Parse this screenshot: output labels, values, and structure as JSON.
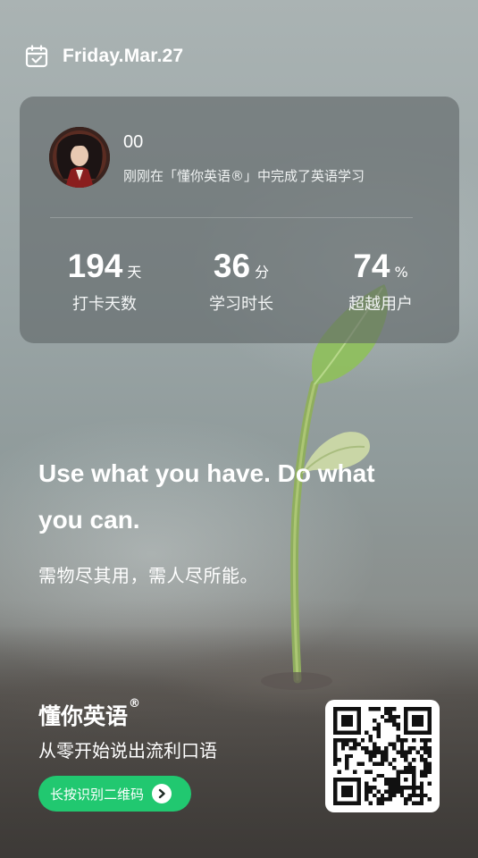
{
  "header": {
    "date": "Friday.Mar.27"
  },
  "user": {
    "name": "00",
    "status": "刚刚在「懂你英语®」中完成了英语学习"
  },
  "stats": [
    {
      "value": "194",
      "unit": "天",
      "label": "打卡天数"
    },
    {
      "value": "36",
      "unit": "分",
      "label": "学习时长"
    },
    {
      "value": "74",
      "unit": "%",
      "label": "超越用户"
    }
  ],
  "quote": {
    "english": "Use what you have. Do what you can.",
    "chinese": "需物尽其用，需人尽所能。"
  },
  "brand": {
    "name": "懂你英语",
    "mark": "®",
    "slogan": "从零开始说出流利口语",
    "cta": "长按识别二维码"
  },
  "colors": {
    "accent": "#21c870",
    "card": "#5f6668"
  },
  "icons": {
    "date": "calendar-check-icon",
    "cta": "chevron-right-circle-icon"
  }
}
